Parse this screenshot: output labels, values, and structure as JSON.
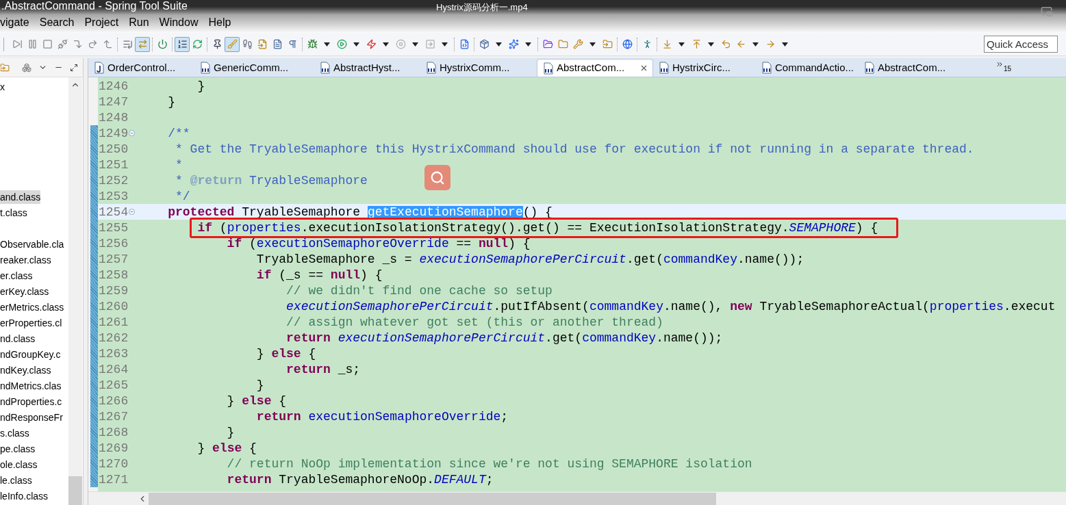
{
  "window": {
    "title": ".AbstractCommand - Spring Tool Suite"
  },
  "video_title": "Hystrix源码分析一.mp4",
  "menu": [
    "vigate",
    "Search",
    "Project",
    "Run",
    "Window",
    "Help"
  ],
  "toolbar": [
    {
      "kind": "button",
      "pressed": false,
      "dropdown": false
    },
    {
      "kind": "button",
      "pressed": false,
      "dropdown": false
    },
    {
      "kind": "button",
      "pressed": false,
      "dropdown": false
    },
    {
      "kind": "button",
      "pressed": false,
      "dropdown": false
    },
    {
      "kind": "button",
      "pressed": false,
      "dropdown": false
    },
    {
      "kind": "button",
      "pressed": false,
      "dropdown": false
    },
    {
      "kind": "button",
      "pressed": false,
      "dropdown": false
    },
    {
      "kind": "separator"
    },
    {
      "kind": "button",
      "pressed": false,
      "dropdown": false
    },
    {
      "kind": "button",
      "pressed": true,
      "dropdown": false
    },
    {
      "kind": "separator"
    },
    {
      "kind": "button",
      "pressed": false,
      "dropdown": false
    },
    {
      "kind": "separator"
    },
    {
      "kind": "button",
      "pressed": true,
      "dropdown": false
    },
    {
      "kind": "button",
      "pressed": false,
      "dropdown": false
    },
    {
      "kind": "separator"
    },
    {
      "kind": "button",
      "pressed": false,
      "dropdown": false
    },
    {
      "kind": "button",
      "pressed": true,
      "dropdown": false
    },
    {
      "kind": "button",
      "pressed": false,
      "dropdown": false
    },
    {
      "kind": "button",
      "pressed": false,
      "dropdown": false
    },
    {
      "kind": "button",
      "pressed": false,
      "dropdown": false
    },
    {
      "kind": "button",
      "pressed": false,
      "dropdown": false
    },
    {
      "kind": "separator"
    },
    {
      "kind": "button",
      "pressed": false,
      "dropdown": true
    },
    {
      "kind": "button",
      "pressed": false,
      "dropdown": true
    },
    {
      "kind": "button",
      "pressed": false,
      "dropdown": true
    },
    {
      "kind": "button",
      "pressed": false,
      "dropdown": true
    },
    {
      "kind": "button",
      "pressed": false,
      "dropdown": true
    },
    {
      "kind": "separator"
    },
    {
      "kind": "button",
      "pressed": false,
      "dropdown": false
    },
    {
      "kind": "separator"
    },
    {
      "kind": "button",
      "pressed": false,
      "dropdown": true
    },
    {
      "kind": "button",
      "pressed": false,
      "dropdown": true
    },
    {
      "kind": "separator"
    },
    {
      "kind": "button",
      "pressed": false,
      "dropdown": false
    },
    {
      "kind": "button",
      "pressed": false,
      "dropdown": false
    },
    {
      "kind": "button",
      "pressed": false,
      "dropdown": true
    },
    {
      "kind": "button",
      "pressed": false,
      "dropdown": false
    },
    {
      "kind": "separator"
    },
    {
      "kind": "button",
      "pressed": false,
      "dropdown": false
    },
    {
      "kind": "separator"
    },
    {
      "kind": "button",
      "pressed": false,
      "dropdown": false
    },
    {
      "kind": "separator"
    },
    {
      "kind": "button",
      "pressed": false,
      "dropdown": true
    },
    {
      "kind": "button",
      "pressed": false,
      "dropdown": true
    },
    {
      "kind": "button",
      "pressed": false,
      "dropdown": false
    },
    {
      "kind": "button",
      "pressed": false,
      "dropdown": true
    },
    {
      "kind": "button",
      "pressed": false,
      "dropdown": true
    }
  ],
  "quick_access": {
    "placeholder": "Quick Access"
  },
  "package_explorer": {
    "items": [
      {
        "label": "x",
        "selected": false
      },
      {
        "label": "and.class",
        "selected": true
      },
      {
        "label": "t.class",
        "selected": false
      },
      {
        "label": "Observable.cla",
        "selected": false
      },
      {
        "label": "reaker.class",
        "selected": false
      },
      {
        "label": "er.class",
        "selected": false
      },
      {
        "label": "erKey.class",
        "selected": false
      },
      {
        "label": "erMetrics.class",
        "selected": false
      },
      {
        "label": "erProperties.cl",
        "selected": false
      },
      {
        "label": "nd.class",
        "selected": false
      },
      {
        "label": "ndGroupKey.c",
        "selected": false
      },
      {
        "label": "ndKey.class",
        "selected": false
      },
      {
        "label": "ndMetrics.clas",
        "selected": false
      },
      {
        "label": "ndProperties.c",
        "selected": false
      },
      {
        "label": "ndResponseFr",
        "selected": false
      },
      {
        "label": "s.class",
        "selected": false
      },
      {
        "label": "pe.class",
        "selected": false
      },
      {
        "label": "ole.class",
        "selected": false
      },
      {
        "label": "le.class",
        "selected": false
      },
      {
        "label": "leInfo.class",
        "selected": false
      }
    ]
  },
  "editor_tabs": [
    {
      "label": "OrderControl...",
      "kind": "java",
      "selected": false
    },
    {
      "label": "GenericComm...",
      "kind": "class",
      "selected": false
    },
    {
      "label": "AbstractHyst...",
      "kind": "class",
      "selected": false
    },
    {
      "label": "HystrixComm...",
      "kind": "class",
      "selected": false
    },
    {
      "label": "AbstractCom...",
      "kind": "class",
      "selected": true
    },
    {
      "label": "HystrixCirc...",
      "kind": "class",
      "selected": false
    },
    {
      "label": "CommandActio...",
      "kind": "class",
      "selected": false
    },
    {
      "label": "AbstractCom...",
      "kind": "class",
      "selected": false
    }
  ],
  "hidden_tabs_count": "15",
  "code_lines": [
    {
      "number": "1246",
      "changed": false,
      "foldable": false,
      "current": false,
      "annotated": false,
      "segments": [
        {
          "kind": "plain",
          "text": "        }"
        }
      ]
    },
    {
      "number": "1247",
      "changed": false,
      "foldable": false,
      "current": false,
      "annotated": false,
      "segments": [
        {
          "kind": "plain",
          "text": "    }"
        }
      ]
    },
    {
      "number": "1248",
      "changed": false,
      "foldable": false,
      "current": false,
      "annotated": false
    },
    {
      "number": "1249",
      "changed": true,
      "foldable": true,
      "current": false,
      "annotated": false,
      "segments": [
        {
          "kind": "javadoc",
          "text": "    /**"
        }
      ]
    },
    {
      "number": "1250",
      "changed": true,
      "foldable": false,
      "current": false,
      "annotated": false,
      "segments": [
        {
          "kind": "javadoc",
          "text": "     * Get the TryableSemaphore this HystrixCommand should use for execution if not running in a separate thread."
        }
      ]
    },
    {
      "number": "1251",
      "changed": true,
      "foldable": false,
      "current": false,
      "annotated": false,
      "segments": [
        {
          "kind": "javadoc",
          "text": "     *"
        }
      ]
    },
    {
      "number": "1252",
      "changed": true,
      "foldable": false,
      "current": false,
      "annotated": false,
      "segments": [
        {
          "kind": "javadoc",
          "text": "     * "
        },
        {
          "kind": "javadoc_tag",
          "text": "@return"
        },
        {
          "kind": "javadoc",
          "text": " TryableSemaphore"
        }
      ]
    },
    {
      "number": "1253",
      "changed": true,
      "foldable": false,
      "current": false,
      "annotated": false,
      "segments": [
        {
          "kind": "javadoc",
          "text": "     */"
        }
      ]
    },
    {
      "number": "1254",
      "changed": true,
      "foldable": true,
      "current": true,
      "annotated": false,
      "segments": [
        {
          "kind": "keyword",
          "text": "    protected"
        },
        {
          "kind": "plain",
          "text": " TryableSemaphore "
        },
        {
          "kind": "selection",
          "text": "getExecutionSemaphore"
        },
        {
          "kind": "plain",
          "text": "() {"
        }
      ]
    },
    {
      "number": "1255",
      "changed": true,
      "foldable": false,
      "current": false,
      "annotated": true,
      "segments": [
        {
          "kind": "keyword",
          "text": "        if"
        },
        {
          "kind": "plain",
          "text": " ("
        },
        {
          "kind": "field",
          "text": "properties"
        },
        {
          "kind": "plain",
          "text": ".executionIsolationStrategy().get() == ExecutionIsolationStrategy."
        },
        {
          "kind": "static",
          "text": "SEMAPHORE"
        },
        {
          "kind": "plain",
          "text": ") {"
        }
      ]
    },
    {
      "number": "1256",
      "changed": true,
      "foldable": false,
      "current": false,
      "annotated": false,
      "segments": [
        {
          "kind": "keyword",
          "text": "            if"
        },
        {
          "kind": "plain",
          "text": " ("
        },
        {
          "kind": "field",
          "text": "executionSemaphoreOverride"
        },
        {
          "kind": "plain",
          "text": " == "
        },
        {
          "kind": "keyword",
          "text": "null"
        },
        {
          "kind": "plain",
          "text": ") {"
        }
      ]
    },
    {
      "number": "1257",
      "changed": true,
      "foldable": false,
      "current": false,
      "annotated": false,
      "segments": [
        {
          "kind": "plain",
          "text": "                TryableSemaphore _s = "
        },
        {
          "kind": "static",
          "text": "executionSemaphorePerCircuit"
        },
        {
          "kind": "plain",
          "text": ".get("
        },
        {
          "kind": "field",
          "text": "commandKey"
        },
        {
          "kind": "plain",
          "text": ".name());"
        }
      ]
    },
    {
      "number": "1258",
      "changed": true,
      "foldable": false,
      "current": false,
      "annotated": false,
      "segments": [
        {
          "kind": "keyword",
          "text": "                if"
        },
        {
          "kind": "plain",
          "text": " (_s == "
        },
        {
          "kind": "keyword",
          "text": "null"
        },
        {
          "kind": "plain",
          "text": ") {"
        }
      ]
    },
    {
      "number": "1259",
      "changed": true,
      "foldable": false,
      "current": false,
      "annotated": false,
      "segments": [
        {
          "kind": "comment",
          "text": "                    // we didn't find one cache so setup"
        }
      ]
    },
    {
      "number": "1260",
      "changed": true,
      "foldable": false,
      "current": false,
      "annotated": false,
      "segments": [
        {
          "kind": "static",
          "text": "                    executionSemaphorePerCircuit"
        },
        {
          "kind": "plain",
          "text": ".putIfAbsent("
        },
        {
          "kind": "field",
          "text": "commandKey"
        },
        {
          "kind": "plain",
          "text": ".name(), "
        },
        {
          "kind": "keyword",
          "text": "new"
        },
        {
          "kind": "plain",
          "text": " TryableSemaphoreActual("
        },
        {
          "kind": "field",
          "text": "properties"
        },
        {
          "kind": "plain",
          "text": ".execut"
        }
      ]
    },
    {
      "number": "1261",
      "changed": true,
      "foldable": false,
      "current": false,
      "annotated": false,
      "segments": [
        {
          "kind": "comment",
          "text": "                    // assign whatever got set (this or another thread)"
        }
      ]
    },
    {
      "number": "1262",
      "changed": true,
      "foldable": false,
      "current": false,
      "annotated": false,
      "segments": [
        {
          "kind": "keyword",
          "text": "                    return "
        },
        {
          "kind": "static",
          "text": "executionSemaphorePerCircuit"
        },
        {
          "kind": "plain",
          "text": ".get("
        },
        {
          "kind": "field",
          "text": "commandKey"
        },
        {
          "kind": "plain",
          "text": ".name());"
        }
      ]
    },
    {
      "number": "1263",
      "changed": true,
      "foldable": false,
      "current": false,
      "annotated": false,
      "segments": [
        {
          "kind": "plain",
          "text": "                } "
        },
        {
          "kind": "keyword",
          "text": "else"
        },
        {
          "kind": "plain",
          "text": " {"
        }
      ]
    },
    {
      "number": "1264",
      "changed": true,
      "foldable": false,
      "current": false,
      "annotated": false,
      "segments": [
        {
          "kind": "keyword",
          "text": "                    return"
        },
        {
          "kind": "plain",
          "text": " _s;"
        }
      ]
    },
    {
      "number": "1265",
      "changed": true,
      "foldable": false,
      "current": false,
      "annotated": false,
      "segments": [
        {
          "kind": "plain",
          "text": "                }"
        }
      ]
    },
    {
      "number": "1266",
      "changed": true,
      "foldable": false,
      "current": false,
      "annotated": false,
      "segments": [
        {
          "kind": "plain",
          "text": "            } "
        },
        {
          "kind": "keyword",
          "text": "else"
        },
        {
          "kind": "plain",
          "text": " {"
        }
      ]
    },
    {
      "number": "1267",
      "changed": true,
      "foldable": false,
      "current": false,
      "annotated": false,
      "segments": [
        {
          "kind": "keyword",
          "text": "                return "
        },
        {
          "kind": "field",
          "text": "executionSemaphoreOverride"
        },
        {
          "kind": "plain",
          "text": ";"
        }
      ]
    },
    {
      "number": "1268",
      "changed": true,
      "foldable": false,
      "current": false,
      "annotated": false,
      "segments": [
        {
          "kind": "plain",
          "text": "            }"
        }
      ]
    },
    {
      "number": "1269",
      "changed": true,
      "foldable": false,
      "current": false,
      "annotated": false,
      "segments": [
        {
          "kind": "plain",
          "text": "        } "
        },
        {
          "kind": "keyword",
          "text": "else"
        },
        {
          "kind": "plain",
          "text": " {"
        }
      ]
    },
    {
      "number": "1270",
      "changed": true,
      "foldable": false,
      "current": false,
      "annotated": false,
      "segments": [
        {
          "kind": "comment",
          "text": "            // return NoOp implementation since we're not using SEMAPHORE isolation"
        }
      ]
    },
    {
      "number": "1271",
      "changed": true,
      "foldable": false,
      "current": false,
      "annotated": false,
      "segments": [
        {
          "kind": "keyword",
          "text": "            return"
        },
        {
          "kind": "plain",
          "text": " TryableSemaphoreNoOp."
        },
        {
          "kind": "static",
          "text": "DEFAULT"
        },
        {
          "kind": "plain",
          "text": ";"
        }
      ]
    }
  ]
}
